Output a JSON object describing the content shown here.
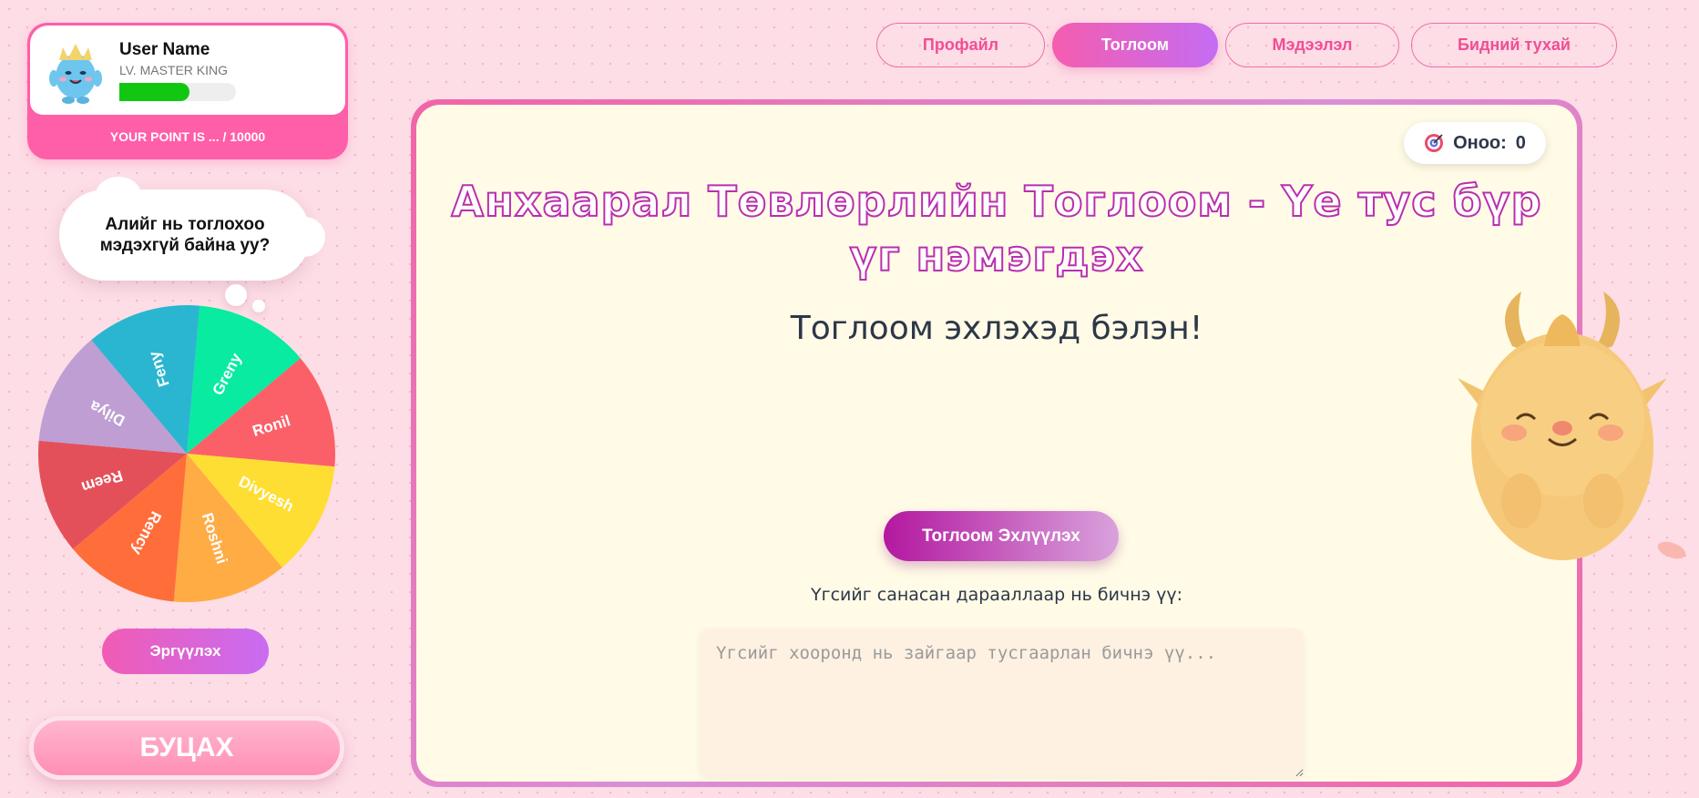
{
  "user": {
    "name": "User Name",
    "level": "LV. MASTER KING",
    "progress": 0.6,
    "points_text": "YOUR POINT IS ... / 10000"
  },
  "sidebar": {
    "bubble_text": "Алийг нь тоглохоо мэдэхгүй байна уу?",
    "spin_label": "Эргүүлэх",
    "back_label": "БУЦАХ"
  },
  "wheel": {
    "names": [
      "Greny",
      "Ronil",
      "Divyesh",
      "Roshni",
      "Rency",
      "Reem",
      "Dilya",
      "Feny"
    ],
    "colors": [
      "#08eba0",
      "#fb6069",
      "#ffde34",
      "#ffac45",
      "#ff6e3a",
      "#e4505a",
      "#be9ed3",
      "#2ab6d0"
    ]
  },
  "nav": {
    "tabs": [
      {
        "label": "Профайл",
        "active": false
      },
      {
        "label": "Тоглоом",
        "active": true
      },
      {
        "label": "Мэдээлэл",
        "active": false
      },
      {
        "label": "Бидний тухай",
        "active": false
      }
    ]
  },
  "game": {
    "score_label": "Оноо:",
    "score_value": "0",
    "title": "Анхаарал Төвлөрлийн Тоглоом - Үе тус бүр үг нэмэгдэх",
    "status": "Тоглоом эхлэхэд бэлэн!",
    "start_label": "Тоглоом Эхлүүлэх",
    "instruction": "Үгсийг санасан дарааллаар нь бичнэ үү:",
    "input_placeholder": "Үгсийг хооронд нь зайгаар тусгаарлан бичнэ үү..."
  },
  "colors": {
    "accent_pink": "#ff5ea8",
    "accent_purple": "#c56cf3",
    "title_stroke": "#b92fb0",
    "panel_bg": "#fffbe6"
  }
}
